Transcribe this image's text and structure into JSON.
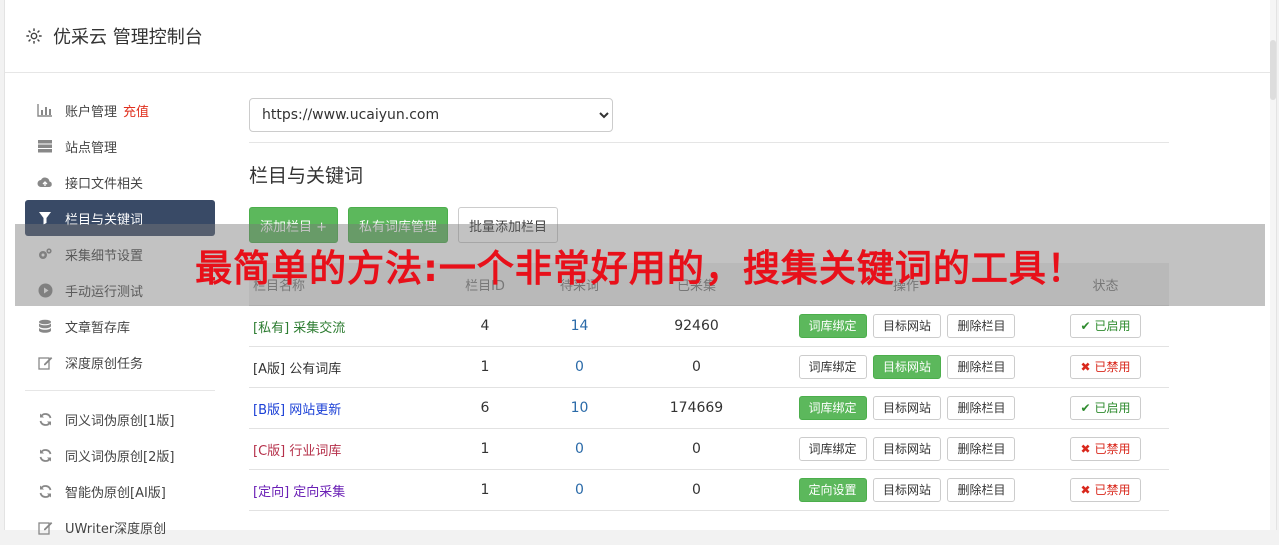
{
  "header": {
    "title": "优采云 管理控制台",
    "icon": "gear-icon"
  },
  "sidebar": {
    "items": [
      {
        "label": "账户管理",
        "extra": "充值",
        "icon": "bar-chart-icon",
        "active": false
      },
      {
        "label": "站点管理",
        "icon": "server-icon",
        "active": false
      },
      {
        "label": "接口文件相关",
        "icon": "cloud-upload-icon",
        "active": false
      },
      {
        "label": "栏目与关键词",
        "icon": "filter-icon",
        "active": true
      },
      {
        "label": "采集细节设置",
        "icon": "cogs-icon",
        "active": false
      },
      {
        "label": "手动运行测试",
        "icon": "play-icon",
        "active": false
      },
      {
        "label": "文章暂存库",
        "icon": "database-icon",
        "active": false
      },
      {
        "label": "深度原创任务",
        "icon": "edit-icon",
        "active": false
      }
    ],
    "items2": [
      {
        "label": "同义词伪原创[1版]",
        "icon": "refresh-icon"
      },
      {
        "label": "同义词伪原创[2版]",
        "icon": "refresh-icon"
      },
      {
        "label": "智能伪原创[AI版]",
        "icon": "refresh-icon"
      },
      {
        "label": "UWriter深度原创",
        "icon": "edit-icon"
      }
    ]
  },
  "main": {
    "site_select": "https://www.ucaiyun.com",
    "section_title": "栏目与关键词",
    "buttons": {
      "add": "添加栏目 +",
      "private": "私有词库管理",
      "batch": "批量添加栏目"
    },
    "table": {
      "headers": [
        "栏目名称",
        "栏目ID",
        "待采词",
        "已采集",
        "操作",
        "状态"
      ],
      "rows": [
        {
          "tag": "[私有]",
          "name": "采集交流",
          "color": "#2e7d32",
          "id": "4",
          "pending": "14",
          "collected": "92460",
          "op1": "词库绑定",
          "op1_green": true,
          "op2": "目标网站",
          "op2_green": false,
          "op3": "删除栏目",
          "status": "已启用",
          "status_on": true
        },
        {
          "tag": "[A版]",
          "name": "公有词库",
          "color": "#333333",
          "id": "1",
          "pending": "0",
          "collected": "0",
          "op1": "词库绑定",
          "op1_green": false,
          "op2": "目标网站",
          "op2_green": true,
          "op3": "删除栏目",
          "status": "已禁用",
          "status_on": false
        },
        {
          "tag": "[B版]",
          "name": "网站更新",
          "color": "#1a3fd6",
          "id": "6",
          "pending": "10",
          "collected": "174669",
          "op1": "词库绑定",
          "op1_green": true,
          "op2": "目标网站",
          "op2_green": false,
          "op3": "删除栏目",
          "status": "已启用",
          "status_on": true
        },
        {
          "tag": "[C版]",
          "name": "行业词库",
          "color": "#b5304a",
          "id": "1",
          "pending": "0",
          "collected": "0",
          "op1": "词库绑定",
          "op1_green": false,
          "op2": "目标网站",
          "op2_green": false,
          "op3": "删除栏目",
          "status": "已禁用",
          "status_on": false
        },
        {
          "tag": "[定向]",
          "name": "定向采集",
          "color": "#6a1fb5",
          "id": "1",
          "pending": "0",
          "collected": "0",
          "op1": "定向设置",
          "op1_green": true,
          "op2": "目标网站",
          "op2_green": false,
          "op3": "删除栏目",
          "status": "已禁用",
          "status_on": false
        }
      ]
    }
  },
  "banner": {
    "text": "最简单的方法:一个非常好用的，搜集关键词的工具！"
  }
}
